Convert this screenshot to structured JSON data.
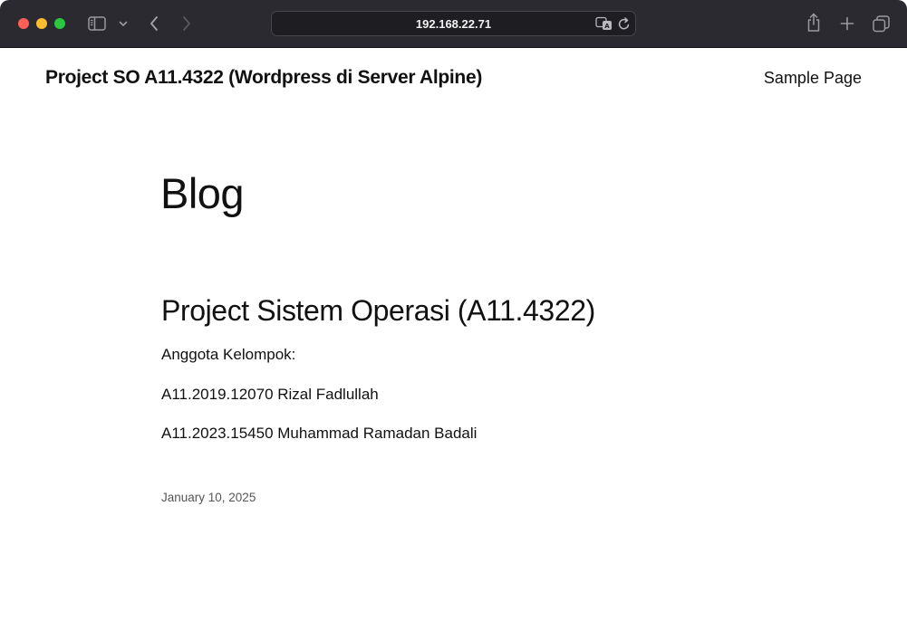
{
  "browser": {
    "url": "192.168.22.71",
    "icons": {
      "sidebar": "sidebar-icon",
      "sidebar_menu": "chevron-down-icon",
      "back": "chevron-left-icon",
      "forward": "chevron-right-icon",
      "translate": "translate-icon",
      "reload": "reload-icon",
      "share": "share-icon",
      "new_tab": "plus-icon",
      "tab_overview": "tabs-icon"
    },
    "colors": {
      "toolbar_bg": "#2b2a30",
      "close": "#fe5f57",
      "minimize": "#febc2e",
      "maximize": "#28c840"
    }
  },
  "site": {
    "title": "Project SO A11.4322 (Wordpress di Server Alpine)",
    "nav": [
      {
        "label": "Sample Page"
      }
    ]
  },
  "main": {
    "heading": "Blog",
    "post": {
      "title": "Project Sistem Operasi (A11.4322)",
      "paragraphs": [
        "Anggota Kelompok:",
        "A11.2019.12070 Rizal Fadlullah",
        "A11.2023.15450 Muhammad Ramadan Badali"
      ],
      "date": "January 10, 2025"
    }
  }
}
